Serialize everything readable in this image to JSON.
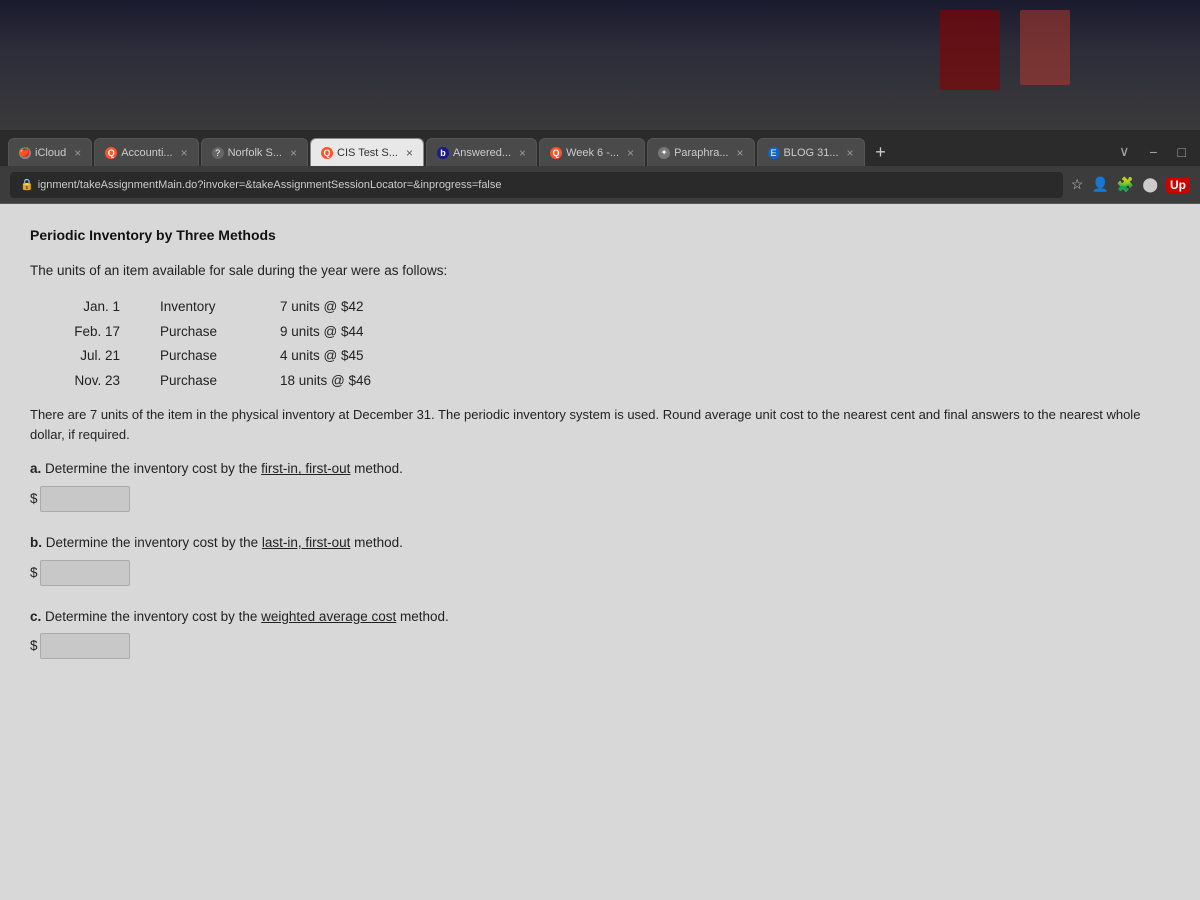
{
  "top_photo": {
    "alt": "decorative background photo"
  },
  "browser": {
    "tabs": [
      {
        "id": "icloud",
        "label": "iCloud",
        "icon_type": "apple",
        "icon_char": "",
        "active": false
      },
      {
        "id": "accounts",
        "label": "Accounti...",
        "icon_type": "brave",
        "icon_char": "Q",
        "active": false
      },
      {
        "id": "norfolk",
        "label": "Norfolk S...",
        "icon_type": "question",
        "icon_char": "?",
        "active": false
      },
      {
        "id": "cis-test",
        "label": "CIS Test S...",
        "icon_type": "brave",
        "icon_char": "Q",
        "active": true
      },
      {
        "id": "answered",
        "label": "Answered...",
        "icon_type": "b-icon",
        "icon_char": "b",
        "active": false
      },
      {
        "id": "week6",
        "label": "Week 6 -...",
        "icon_type": "brave",
        "icon_char": "Q",
        "active": false
      },
      {
        "id": "paraphra",
        "label": "Paraphra...",
        "icon_type": "paraphra",
        "icon_char": "✦",
        "active": false
      },
      {
        "id": "blog31",
        "label": "BLOG 31...",
        "icon_type": "blog",
        "icon_char": "E",
        "active": false
      }
    ],
    "address_bar": {
      "url": "ignment/takeAssignmentMain.do?invoker=&takeAssignmentSessionLocator=&inprogress=false",
      "lock_icon": "🔒"
    }
  },
  "page": {
    "title": "Periodic Inventory by Three Methods",
    "intro": "The units of an item available for sale during the year were as follows:",
    "inventory_items": [
      {
        "date": "Jan. 1",
        "type": "Inventory",
        "amount": "7 units @ $42"
      },
      {
        "date": "Feb. 17",
        "type": "Purchase",
        "amount": "9 units @ $44"
      },
      {
        "date": "Jul. 21",
        "type": "Purchase",
        "amount": "4 units @ $45"
      },
      {
        "date": "Nov. 23",
        "type": "Purchase",
        "amount": "18 units @ $46"
      }
    ],
    "description": "There are 7 units of the item in the physical inventory at December 31. The periodic inventory system is used. Round average unit cost to the nearest cent and final answers to the nearest whole dollar, if required.",
    "questions": [
      {
        "id": "a",
        "label_prefix": "a.",
        "label_text": "Determine the inventory cost by the ",
        "label_underline": "first-in, first-out",
        "label_suffix": " method.",
        "input_placeholder": ""
      },
      {
        "id": "b",
        "label_prefix": "b.",
        "label_text": "Determine the inventory cost by the ",
        "label_underline": "last-in, first-out",
        "label_suffix": " method.",
        "input_placeholder": ""
      },
      {
        "id": "c",
        "label_prefix": "c.",
        "label_text": "Determine the inventory cost by the ",
        "label_underline": "weighted average cost",
        "label_suffix": " method.",
        "input_placeholder": ""
      }
    ],
    "dollar_sign": "$"
  }
}
